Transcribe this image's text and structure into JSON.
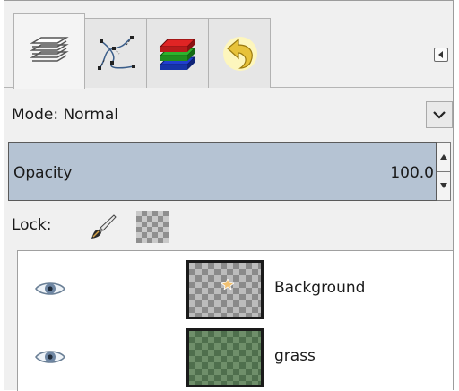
{
  "tabs": [
    {
      "icon": "layers-icon",
      "active": true
    },
    {
      "icon": "paths-icon",
      "active": false
    },
    {
      "icon": "channels-icon",
      "active": false
    },
    {
      "icon": "undo-history-icon",
      "active": false
    }
  ],
  "mode": {
    "label": "Mode: Normal"
  },
  "opacity": {
    "label": "Opacity",
    "value": "100.0"
  },
  "lock": {
    "label": "Lock:"
  },
  "layers": [
    {
      "name": "Background",
      "visible": true,
      "thumbnail": "transparent-checker-with-spark"
    },
    {
      "name": "grass",
      "visible": true,
      "thumbnail": "green-checker"
    }
  ],
  "colors": {
    "opacity_bar": "#b5c3d3",
    "tab_active": "#f4f4f4",
    "panel_bg": "#f0f0f0"
  }
}
